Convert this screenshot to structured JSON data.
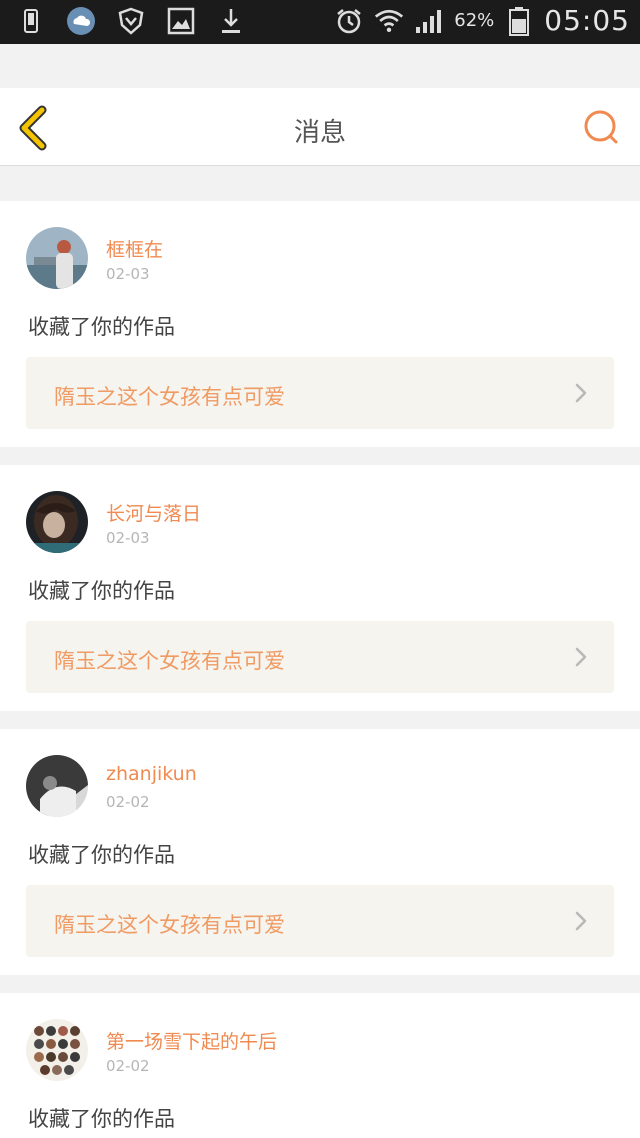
{
  "status_bar": {
    "battery_percent": "62%",
    "time": "05:05",
    "icons": [
      "phone-icon",
      "weather-cloud-icon",
      "shield-icon",
      "image-icon",
      "download-icon",
      "alarm-icon",
      "wifi-icon",
      "signal-icon",
      "battery-icon"
    ]
  },
  "header": {
    "title": "消息",
    "back_icon": "chevron-left-icon",
    "search_icon": "search-icon"
  },
  "colors": {
    "accent": "#f08a50",
    "back_icon": "#f5c400",
    "card_link_bg": "#f5f4ee",
    "page_bg": "#f2f2f2"
  },
  "messages": [
    {
      "username": "框框在",
      "date": "02-03",
      "action": "收藏了你的作品",
      "work_title": "隋玉之这个女孩有点可爱"
    },
    {
      "username": "长河与落日",
      "date": "02-03",
      "action": "收藏了你的作品",
      "work_title": "隋玉之这个女孩有点可爱"
    },
    {
      "username": "zhanjikun",
      "date": "02-02",
      "action": "收藏了你的作品",
      "work_title": "隋玉之这个女孩有点可爱"
    },
    {
      "username": "第一场雪下起的午后",
      "date": "02-02",
      "action": "收藏了你的作品"
    }
  ]
}
